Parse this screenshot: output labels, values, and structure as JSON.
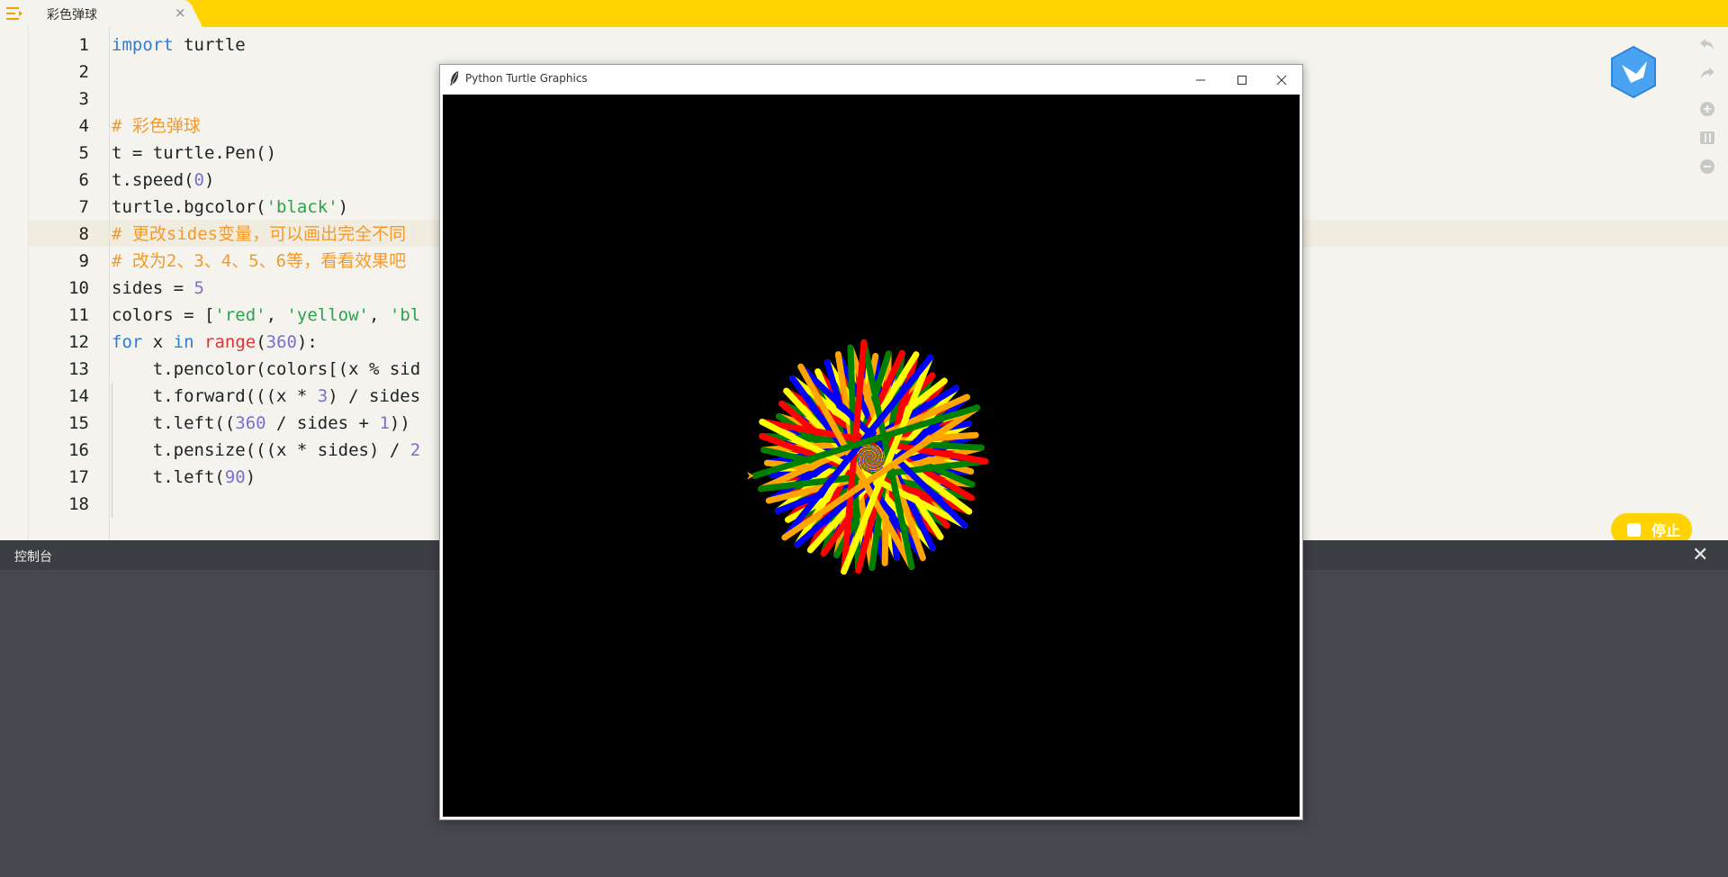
{
  "tab": {
    "title": "彩色弹球",
    "close_icon": "×"
  },
  "editor": {
    "line_numbers": [
      "1",
      "2",
      "3",
      "4",
      "5",
      "6",
      "7",
      "8",
      "9",
      "10",
      "11",
      "12",
      "13",
      "14",
      "15",
      "16",
      "17",
      "18"
    ]
  },
  "code_tokens": {
    "l1": [
      "import",
      " turtle"
    ],
    "l4": "# 彩色弹球",
    "l5": "t = turtle.Pen()",
    "l6": [
      "t.speed(",
      "0",
      ")"
    ],
    "l7": [
      "turtle.bgcolor(",
      "'black'",
      ")"
    ],
    "l8": "# 更改sides变量，可以画出完全不同",
    "l9": "# 改为2、3、4、5、6等，看看效果吧",
    "l10": [
      "sides = ",
      "5"
    ],
    "l11": [
      "colors = [",
      "'red'",
      ", ",
      "'yellow'",
      ", ",
      "'bl"
    ],
    "l12": [
      "for",
      " x ",
      "in",
      " ",
      "range",
      "(",
      "360",
      "):"
    ],
    "l13": "    t.pencolor(colors[(x % sid",
    "l14": [
      "    t.forward(((x * ",
      "3",
      ") / sides"
    ],
    "l15": [
      "    t.left((",
      "360",
      " / sides + ",
      "1",
      "))"
    ],
    "l16": [
      "    t.pensize(((x * sides) / ",
      "2"
    ],
    "l17": [
      "    t.left(",
      "90",
      ")"
    ]
  },
  "stop_button": {
    "label": "停止",
    "icon": "stop-square-icon"
  },
  "console": {
    "title": "控制台",
    "close": "✕"
  },
  "turtle_window": {
    "title": "Python Turtle Graphics",
    "icon": "feather-icon",
    "background": "#000000",
    "pen_colors": [
      "#ff0000",
      "#ffff00",
      "#0000ff",
      "#ffa500",
      "#008000"
    ],
    "sides": 5,
    "iterations": 360
  },
  "toolbar_icons": [
    "undo-icon",
    "redo-icon",
    "zoom-in-icon",
    "layout-icon",
    "zoom-out-icon"
  ],
  "colors": {
    "accent": "#ffd200",
    "console": "#45484d",
    "keyword": "#2f7dd2",
    "comment": "#f39a2a",
    "string": "#2ba24c",
    "number": "#7b6fd0"
  }
}
